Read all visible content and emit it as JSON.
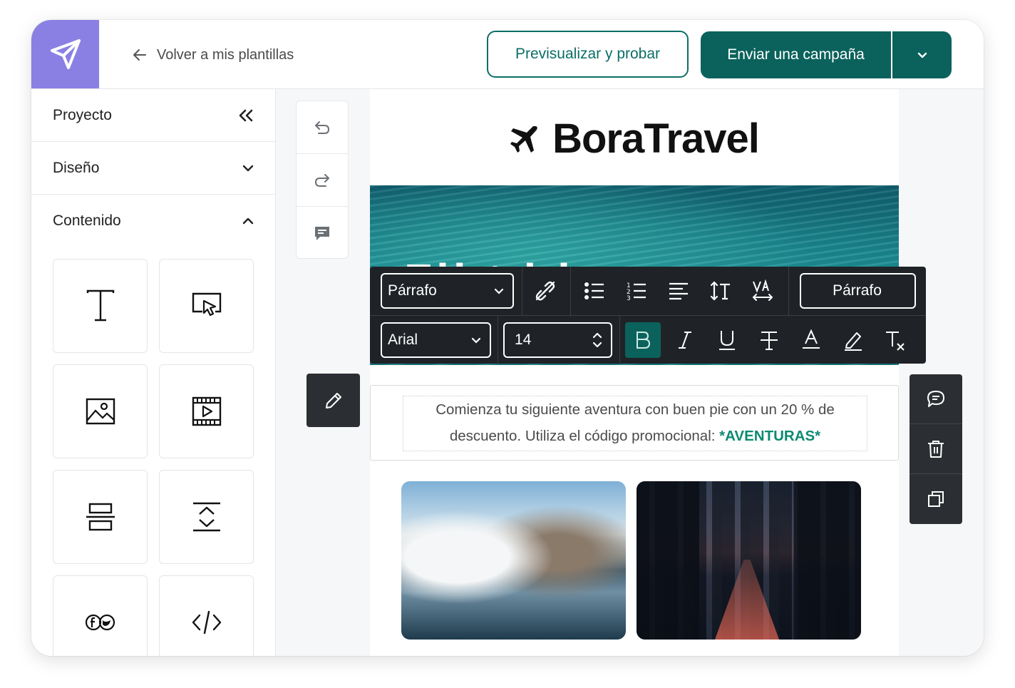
{
  "header": {
    "back_label": "Volver a mis plantillas",
    "preview_label": "Previsualizar y probar",
    "send_label": "Enviar una campaña"
  },
  "sidebar": {
    "sections": [
      {
        "label": "Proyecto"
      },
      {
        "label": "Diseño"
      },
      {
        "label": "Contenido"
      }
    ],
    "tiles": [
      "text-block",
      "button-block",
      "image-block",
      "video-block",
      "divider-block",
      "spacer-block",
      "social-block",
      "html-block"
    ]
  },
  "email": {
    "brand": "BoraTravel",
    "hero_text": "Fli  t      i      l",
    "body_text": "Comienza tu siguiente aventura con buen pie con un 20 % de descuento. Utiliza el código promocional:",
    "promo_code": "*AVENTURAS*"
  },
  "toolbar": {
    "block_type": "Párrafo",
    "style_label": "Párrafo",
    "font": "Arial",
    "size": "14"
  },
  "colors": {
    "accent": "#0b625c",
    "logo_bg": "#8a80e4",
    "toolbar_bg": "#1f2327",
    "promo": "#0c8a73"
  }
}
